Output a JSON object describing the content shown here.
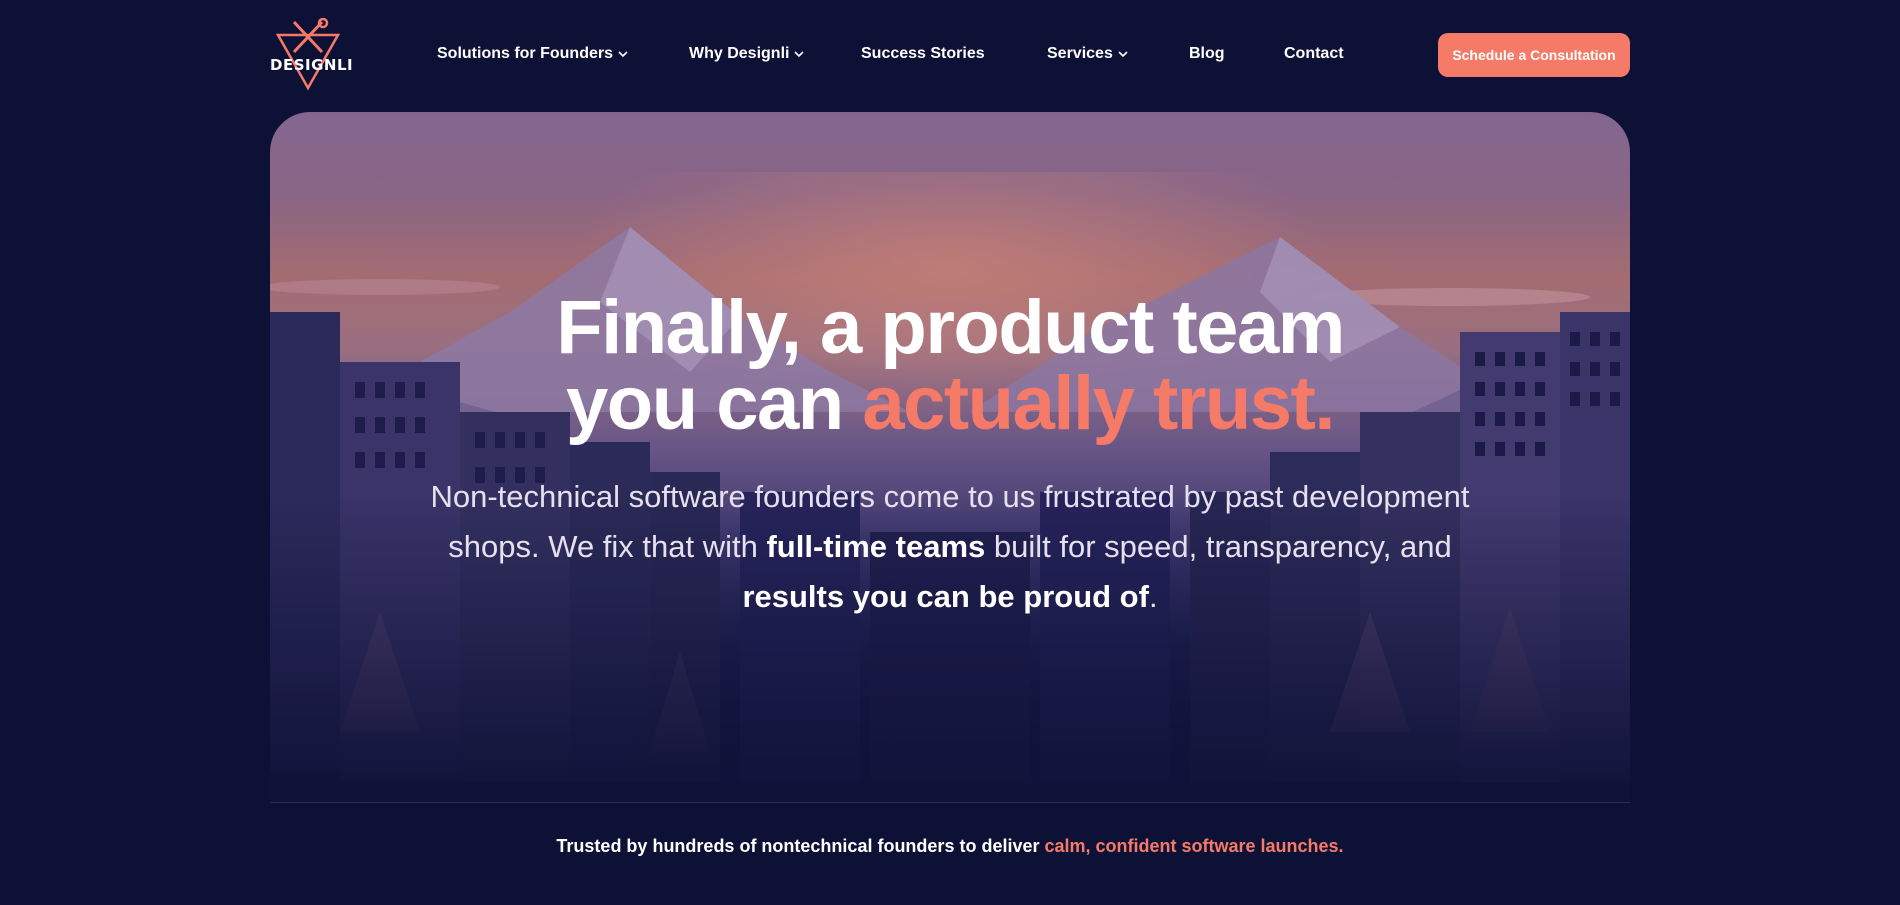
{
  "brand": {
    "logo_text": "DESIGNLI",
    "accent_color": "#f57a68",
    "background_color": "#0e1136"
  },
  "nav": {
    "items": [
      {
        "label": "Solutions for Founders",
        "has_dropdown": true
      },
      {
        "label": "Why Designli",
        "has_dropdown": true
      },
      {
        "label": "Success Stories",
        "has_dropdown": false
      },
      {
        "label": "Services",
        "has_dropdown": true
      },
      {
        "label": "Blog",
        "has_dropdown": false
      },
      {
        "label": "Contact",
        "has_dropdown": false
      }
    ],
    "cta_label": "Schedule a Consultation"
  },
  "hero": {
    "title_line1": "Finally, a product team",
    "title_line2_plain": "you can ",
    "title_line2_accent": "actually trust.",
    "sub_part1": "Non-technical software founders come to us frustrated by past development shops. We fix that with ",
    "sub_bold1": "full-time teams",
    "sub_part2": " built for speed, transparency, and ",
    "sub_bold2": "results you can be proud of",
    "sub_part3": "."
  },
  "trust": {
    "text_plain": "Trusted by hundreds of nontechnical founders to deliver ",
    "text_accent": "calm, confident software launches."
  }
}
